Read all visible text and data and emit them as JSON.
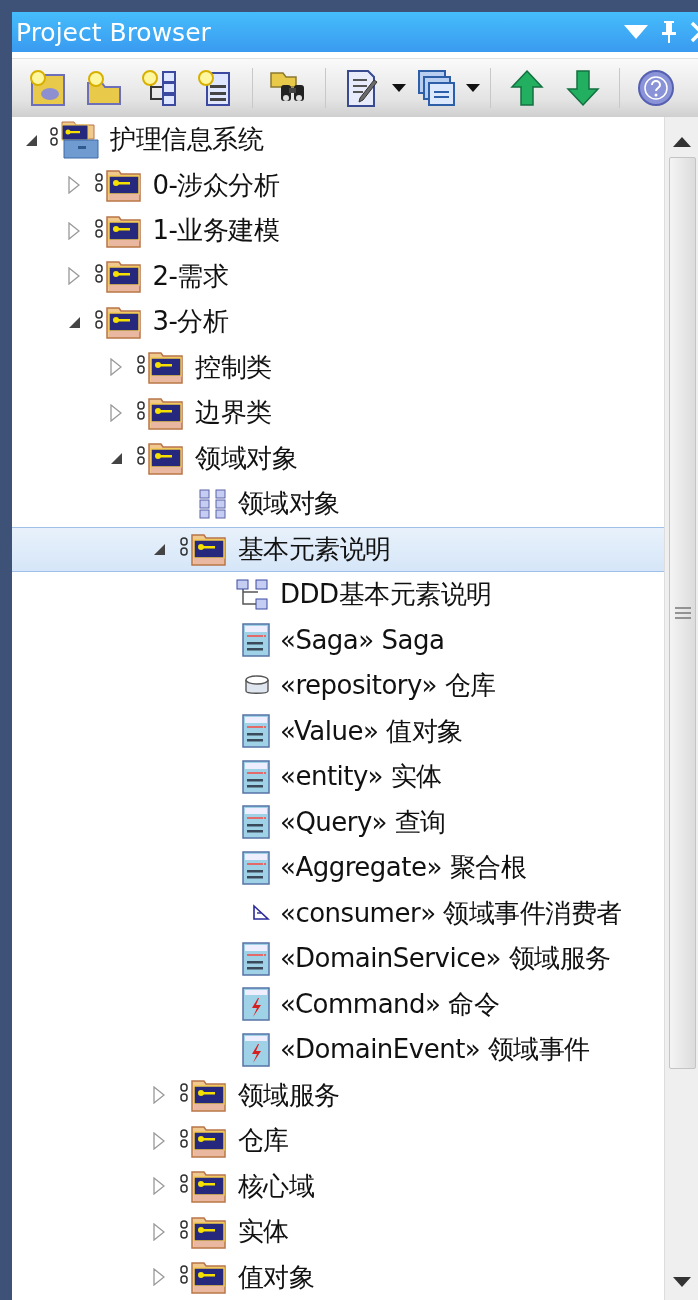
{
  "window": {
    "title": "Project Browser"
  },
  "toolbar": [
    {
      "kind": "new-model"
    },
    {
      "kind": "new-package"
    },
    {
      "kind": "new-diagram"
    },
    {
      "kind": "new-element"
    },
    {
      "kind": "separator"
    },
    {
      "kind": "find"
    },
    {
      "kind": "separator"
    },
    {
      "kind": "document",
      "dropdown": true
    },
    {
      "kind": "windows",
      "dropdown": true
    },
    {
      "kind": "separator"
    },
    {
      "kind": "move-up"
    },
    {
      "kind": "move-down"
    },
    {
      "kind": "separator"
    },
    {
      "kind": "help"
    }
  ],
  "tree": [
    {
      "label": "护理信息系统",
      "kind": "model",
      "expanded": true,
      "selected": false,
      "children": [
        {
          "label": "0-涉众分析",
          "kind": "package",
          "expanded": false,
          "selected": false
        },
        {
          "label": "1-业务建模",
          "kind": "package",
          "expanded": false,
          "selected": false
        },
        {
          "label": "2-需求",
          "kind": "package",
          "expanded": false,
          "selected": false
        },
        {
          "label": "3-分析",
          "kind": "package",
          "expanded": true,
          "selected": false,
          "children": [
            {
              "label": "控制类",
              "kind": "package",
              "expanded": false,
              "selected": false
            },
            {
              "label": "边界类",
              "kind": "package",
              "expanded": false,
              "selected": false
            },
            {
              "label": "领域对象",
              "kind": "package",
              "expanded": true,
              "selected": false,
              "children": [
                {
                  "label": "领域对象",
                  "kind": "diagram-grid",
                  "selected": false
                },
                {
                  "label": "基本元素说明",
                  "kind": "package",
                  "expanded": true,
                  "selected": true,
                  "children": [
                    {
                      "label": "DDD基本元素说明",
                      "kind": "diagram-tree",
                      "selected": false
                    },
                    {
                      "label": "«Saga» Saga",
                      "kind": "class",
                      "selected": false
                    },
                    {
                      "label": "«repository» 仓库",
                      "kind": "repository",
                      "selected": false
                    },
                    {
                      "label": "«Value» 值对象",
                      "kind": "class",
                      "selected": false
                    },
                    {
                      "label": "«entity» 实体",
                      "kind": "class",
                      "selected": false
                    },
                    {
                      "label": "«Query» 查询",
                      "kind": "class",
                      "selected": false
                    },
                    {
                      "label": "«Aggregate» 聚合根",
                      "kind": "class",
                      "selected": false
                    },
                    {
                      "label": "«consumer» 领域事件消费者",
                      "kind": "consumer",
                      "selected": false
                    },
                    {
                      "label": "«DomainService» 领域服务",
                      "kind": "class",
                      "selected": false
                    },
                    {
                      "label": "«Command» 命令",
                      "kind": "event",
                      "selected": false
                    },
                    {
                      "label": "«DomainEvent» 领域事件",
                      "kind": "event",
                      "selected": false
                    }
                  ]
                },
                {
                  "label": "领域服务",
                  "kind": "package",
                  "expanded": false,
                  "selected": false
                },
                {
                  "label": "仓库",
                  "kind": "package",
                  "expanded": false,
                  "selected": false
                },
                {
                  "label": "核心域",
                  "kind": "package",
                  "expanded": false,
                  "selected": false
                },
                {
                  "label": "实体",
                  "kind": "package",
                  "expanded": false,
                  "selected": false
                },
                {
                  "label": "值对象",
                  "kind": "package",
                  "expanded": false,
                  "selected": false
                }
              ]
            }
          ]
        }
      ]
    }
  ]
}
